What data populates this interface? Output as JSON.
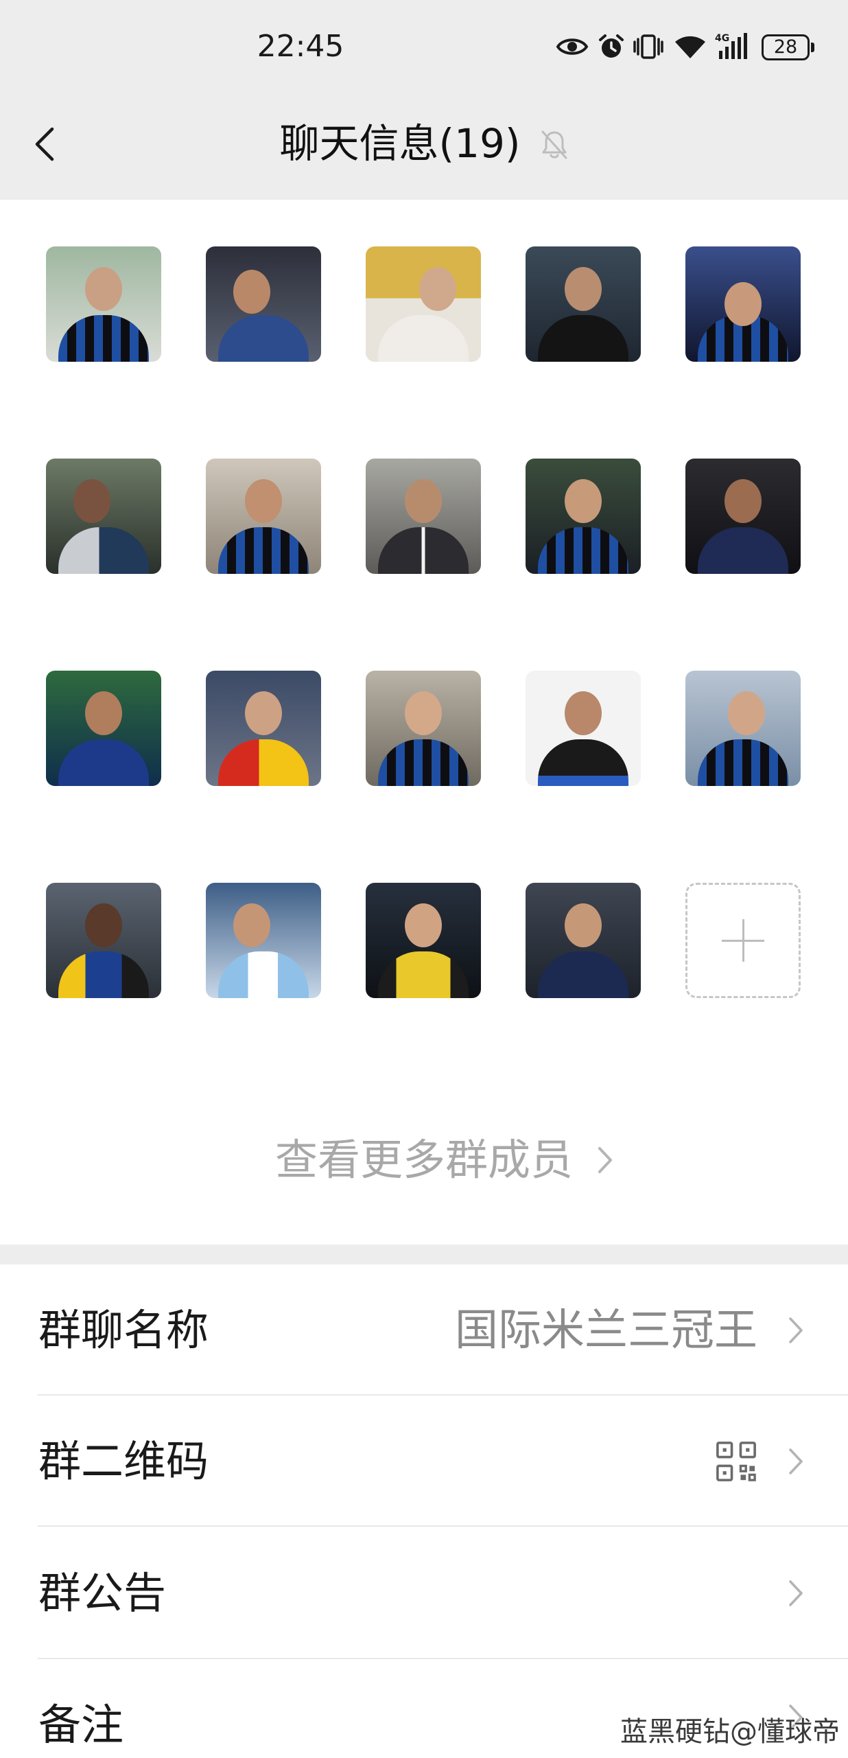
{
  "status_bar": {
    "time": "22:45",
    "network": "4G",
    "battery": "28",
    "icons": [
      "eye-icon",
      "alarm-icon",
      "vibrate-icon",
      "wifi-icon",
      "signal-icon",
      "battery-icon"
    ]
  },
  "header": {
    "title": "聊天信息(19)",
    "back_icon": "chevron-left-icon",
    "mute_icon": "bell-off-icon"
  },
  "members": {
    "add_icon": "plus-icon",
    "view_more_label": "查看更多群成员",
    "view_more_icon": "chevron-right-icon"
  },
  "settings": [
    {
      "label": "群聊名称",
      "value": "国际米兰三冠王"
    },
    {
      "label": "群二维码",
      "icon": "qr-code-icon"
    },
    {
      "label": "群公告"
    },
    {
      "label": "备注"
    }
  ],
  "watermark": "蓝黑硬钻@懂球帝",
  "colors": {
    "header_bg": "#ededed",
    "content_bg": "#ffffff",
    "primary_text": "#1a1a1a",
    "secondary_text": "#8a8a8a"
  }
}
